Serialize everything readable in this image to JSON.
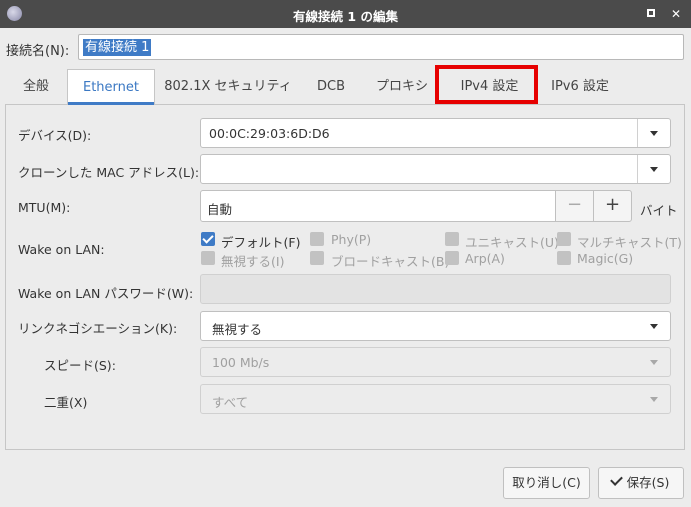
{
  "window": {
    "title": "有線接続 1 の編集"
  },
  "connection": {
    "name_label": "接続名(N):",
    "name_value": "有線接続 1"
  },
  "tabs": [
    {
      "label": "全般"
    },
    {
      "label": "Ethernet"
    },
    {
      "label": "802.1X セキュリティ"
    },
    {
      "label": "DCB"
    },
    {
      "label": "プロキシ"
    },
    {
      "label": "IPv4 設定"
    },
    {
      "label": "IPv6 設定"
    }
  ],
  "active_tab": "Ethernet",
  "highlighted_tab": "IPv4 設定",
  "highlight_color": "#e60000",
  "accent_color": "#3f7bc6",
  "ethernet": {
    "device_label": "デバイス(D):",
    "device_value": "00:0C:29:03:6D:D6",
    "cloned_mac_label": "クローンした MAC アドレス(L):",
    "cloned_mac_value": "",
    "mtu_label": "MTU(M):",
    "mtu_value": "自動",
    "mtu_minus": "−",
    "mtu_plus": "+",
    "mtu_unit": "バイト",
    "wol_label": "Wake on LAN:",
    "wol_options": [
      {
        "label": "デフォルト(F)",
        "checked": true,
        "enabled": true
      },
      {
        "label": "Phy(P)",
        "checked": false,
        "enabled": false
      },
      {
        "label": "ユニキャスト(U)",
        "checked": false,
        "enabled": false
      },
      {
        "label": "マルチキャスト(T)",
        "checked": false,
        "enabled": false
      },
      {
        "label": "無視する(I)",
        "checked": false,
        "enabled": false
      },
      {
        "label": "ブロードキャスト(B)",
        "checked": false,
        "enabled": false
      },
      {
        "label": "Arp(A)",
        "checked": false,
        "enabled": false
      },
      {
        "label": "Magic(G)",
        "checked": false,
        "enabled": false
      }
    ],
    "wol_password_label": "Wake on LAN パスワード(W):",
    "wol_password_value": "",
    "link_negotiation_label": "リンクネゴシエーション(K):",
    "link_negotiation_value": "無視する",
    "speed_label": "スピード(S):",
    "speed_value": "100 Mb/s",
    "duplex_label": "二重(X)",
    "duplex_value": "すべて"
  },
  "buttons": {
    "cancel": "取り消し(C)",
    "save": "保存(S)"
  }
}
